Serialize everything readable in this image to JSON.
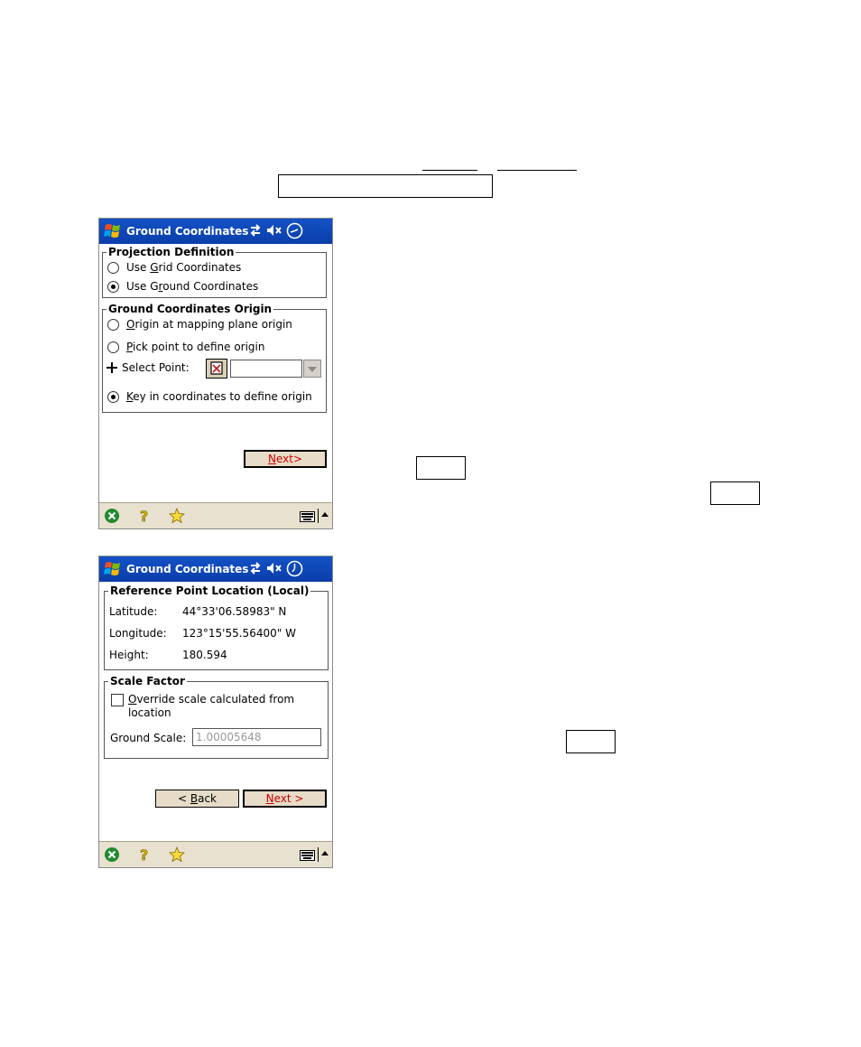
{
  "screen1": {
    "title": "Ground Coordinates",
    "projection_legend": "Projection Definition",
    "grid_option": {
      "pre": "Use ",
      "u": "G",
      "post": "rid Coordinates"
    },
    "ground_option": {
      "pre": "Use G",
      "u": "r",
      "post": "ound Coordinates"
    },
    "origin_legend": "Ground Coordinates Origin",
    "origin_mapping": {
      "pre": "",
      "u": "O",
      "post": "rigin at mapping plane origin"
    },
    "origin_pick": {
      "pre": "",
      "u": "P",
      "post": "ick point to define origin"
    },
    "select_point_label": "Select Point:",
    "origin_key_in": {
      "pre": "",
      "u": "K",
      "post": "ey in coordinates to define origin"
    },
    "next_button": {
      "u": "N",
      "post": "ext>"
    },
    "selected": "ground",
    "origin_selected": "key_in"
  },
  "screen2": {
    "title": "Ground Coordinates",
    "ref_legend": "Reference Point Location (Local)",
    "latitude_label": "Latitude:",
    "latitude_value": "44°33'06.58983\" N",
    "longitude_label": "Longitude:",
    "longitude_value": "123°15'55.56400\" W",
    "height_label": "Height:",
    "height_value": "180.594",
    "scale_legend": "Scale Factor",
    "override_line1": {
      "u": "O",
      "post": "verride scale calculated from"
    },
    "override_line2": "location",
    "ground_scale_label": "Ground Scale:",
    "ground_scale_value": "1.00005648",
    "back_button": {
      "pre": "< ",
      "u": "B",
      "post": "ack"
    },
    "next_button": {
      "u": "N",
      "post": "ext >"
    },
    "override_checked": false
  },
  "colors": {
    "titlebar": "#0a3ea9",
    "taskbar": "#e9e1cf",
    "button_face": "#e6dcc8",
    "default_button_text": "#cc0000"
  },
  "icons": [
    "windows-start-icon",
    "connectivity-icon",
    "speaker-mute-icon",
    "clock-icon",
    "close-ok-icon",
    "help-icon",
    "favorites-star-icon",
    "keyboard-icon"
  ]
}
